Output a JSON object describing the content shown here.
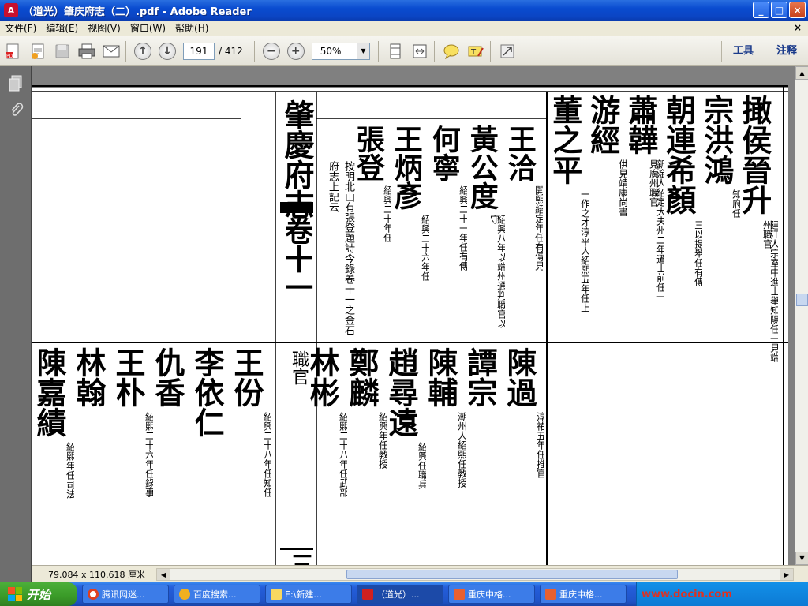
{
  "window": {
    "title": "（道光）肇庆府志（二）.pdf - Adobe Reader",
    "buttons": {
      "minimize": "_",
      "maximize": "□",
      "close": "×"
    }
  },
  "menu": [
    "文件(F)",
    "编辑(E)",
    "视图(V)",
    "窗口(W)",
    "帮助(H)"
  ],
  "toolbar": {
    "current_page": "191",
    "total_pages": "/ 412",
    "zoom": "50%",
    "tools_label": "工具",
    "comment_label": "注释"
  },
  "status": {
    "page_size": "79.084 x 110.618 厘米"
  },
  "document": {
    "top_right_columns": [
      {
        "big": "撖侯晉升",
        "small": "建江人宗室中進士舉知陽任一見端州職官"
      },
      {
        "big": "宗洪鴻",
        "small": "知府任"
      },
      {
        "big": "朝連希顏",
        "small": "三以提舉任有傳"
      },
      {
        "big": "蕭韡",
        "small": "新淦人紹定大夫州二年遷士前任一見廣州職官"
      },
      {
        "big": "游經",
        "small": "供見靖康尚書"
      },
      {
        "big": "董之平",
        "small": "一作之才淳平人紹熙五年任上"
      }
    ],
    "top_middle_columns": [
      {
        "big": "王洽",
        "small": "開熙紹定年任有傳見"
      },
      {
        "big": "黃公度",
        "small": "紹興八年以端州通判職官以守"
      },
      {
        "big": "何寧",
        "small": "紹興二十一年任有傳"
      },
      {
        "big": "王炳彥",
        "small": "紹興二十六年任"
      },
      {
        "big": "張登",
        "small": "紹興二十年任"
      }
    ],
    "top_note": "按明北山有張登題詩今錄卷十一之金石府志上記云",
    "spine_title": "肇慶府志",
    "spine_volume": "卷十一",
    "spine_office": "職官",
    "spine_page": "三",
    "bottom_right_columns": [
      {
        "big": "陳過",
        "small": "淳祐五年任推官"
      },
      {
        "big": "譚宗",
        "small": ""
      },
      {
        "big": "陳輔",
        "small": "潮州人紹熙任教授"
      },
      {
        "big": "趙尋遠",
        "small": "紹興任職兵"
      },
      {
        "big": "鄭麟",
        "small": "紹興年任教授"
      },
      {
        "big": "林彬",
        "small": "紹熙二十八年任武部"
      }
    ],
    "bottom_left_columns": [
      {
        "big": "王份",
        "small": "紹興二十八年任知任"
      },
      {
        "big": "李依仁",
        "small": ""
      },
      {
        "big": "仇香",
        "small": ""
      },
      {
        "big": "王朴",
        "small": "紹熙二十六年任錄事"
      },
      {
        "big": "林翰",
        "small": ""
      },
      {
        "big": "陳嘉績",
        "small": "紹熙年任司法"
      }
    ]
  },
  "taskbar": {
    "start_label": "开始",
    "tasks": [
      "腾讯网迷...",
      "百度搜索...",
      "E:\\新建...",
      "（道光）...",
      "重庆中格...",
      "重庆中格..."
    ],
    "tray_text": "www.docin.com"
  },
  "colors": {
    "titlebar": "#0a4cd0",
    "taskbar": "#245edb",
    "start": "#3a9a28",
    "docbg": "#808080"
  }
}
